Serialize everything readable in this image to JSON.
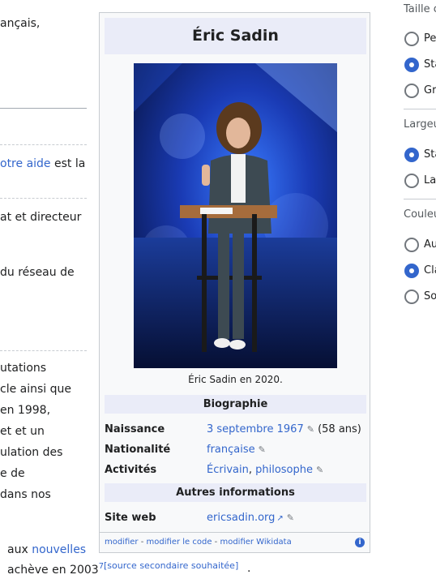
{
  "article": {
    "lines": [
      "ançais,",
      "otre aide",
      " est la",
      "at et directeur",
      " du réseau de",
      "utations",
      "cle ainsi que",
      "en 1998,",
      "et et un",
      "ulation des",
      "e de",
      "dans nos",
      "aux",
      "nouvelles"
    ],
    "bottom": {
      "prefix": "achève en 2003",
      "sup": "7,",
      "source": "[source secondaire souhaitée]",
      "suffix": "."
    }
  },
  "infobox": {
    "title": "Éric Sadin",
    "caption": "Éric Sadin en 2020.",
    "section_bio": "Biographie",
    "naissance_label": "Naissance",
    "naissance_value": "3 septembre 1967",
    "naissance_age": "(58 ans)",
    "nationalite_label": "Nationalité",
    "nationalite_value": "française",
    "activites_label": "Activités",
    "activite_1": "Écrivain",
    "activite_sep": ", ",
    "activite_2": "philosophe",
    "section_other": "Autres informations",
    "site_label": "Site web",
    "site_value": "ericsadin.org",
    "footer_modifier": "modifier",
    "footer_sep1": " - ",
    "footer_code": "modifier le code",
    "footer_sep2": " - ",
    "footer_wikidata": "modifier Wikidata",
    "info_icon": "i"
  },
  "panel": {
    "taille_heading": "Taille c",
    "taille_options": [
      "Pe",
      "Sta",
      "Gr"
    ],
    "largeur_heading": "Largeu",
    "largeur_options": [
      "Sta",
      "La"
    ],
    "couleur_heading": "Couleu",
    "couleur_options": [
      "Au",
      "Cla",
      "So"
    ]
  },
  "colors": {
    "link": "#3366cc",
    "infobox_header_bg": "#eaecf8",
    "infobox_bg": "#f8f9fa",
    "border": "#c8ccd1"
  }
}
